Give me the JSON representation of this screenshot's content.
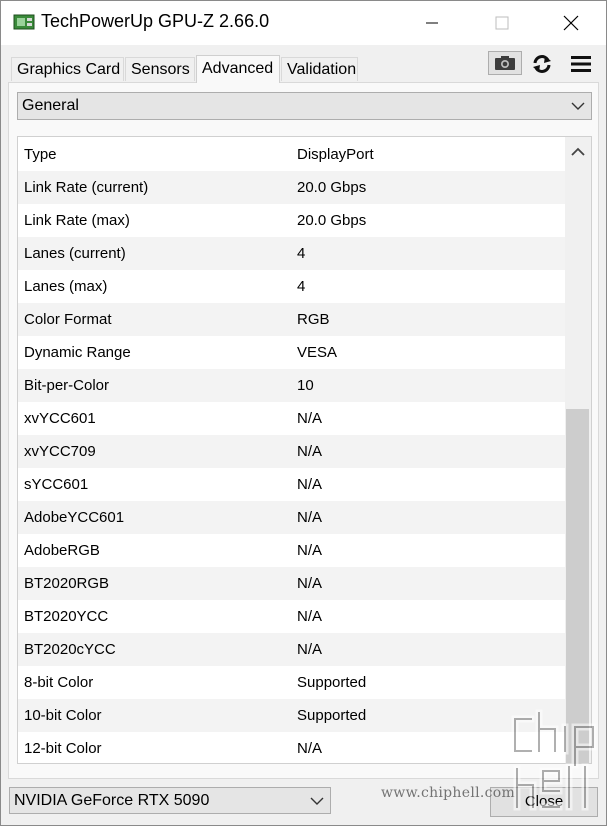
{
  "window": {
    "title": "TechPowerUp GPU-Z 2.66.0"
  },
  "tabs": [
    {
      "label": "Graphics Card",
      "active": false
    },
    {
      "label": "Sensors",
      "active": false
    },
    {
      "label": "Advanced",
      "active": true
    },
    {
      "label": "Validation",
      "active": false
    }
  ],
  "section_dropdown": {
    "selected": "General"
  },
  "rows": [
    {
      "key": "Type",
      "value": "DisplayPort"
    },
    {
      "key": "Link Rate (current)",
      "value": "20.0 Gbps"
    },
    {
      "key": "Link Rate (max)",
      "value": "20.0 Gbps"
    },
    {
      "key": "Lanes (current)",
      "value": "4"
    },
    {
      "key": "Lanes (max)",
      "value": "4"
    },
    {
      "key": "Color Format",
      "value": "RGB"
    },
    {
      "key": "Dynamic Range",
      "value": "VESA"
    },
    {
      "key": "Bit-per-Color",
      "value": "10"
    },
    {
      "key": "xvYCC601",
      "value": "N/A"
    },
    {
      "key": "xvYCC709",
      "value": "N/A"
    },
    {
      "key": "sYCC601",
      "value": "N/A"
    },
    {
      "key": "AdobeYCC601",
      "value": "N/A"
    },
    {
      "key": "AdobeRGB",
      "value": "N/A"
    },
    {
      "key": "BT2020RGB",
      "value": "N/A"
    },
    {
      "key": "BT2020YCC",
      "value": "N/A"
    },
    {
      "key": "BT2020cYCC",
      "value": "N/A"
    },
    {
      "key": "8-bit Color",
      "value": "Supported"
    },
    {
      "key": "10-bit Color",
      "value": "Supported"
    },
    {
      "key": "12-bit Color",
      "value": "N/A"
    }
  ],
  "gpu_select": {
    "selected": "NVIDIA GeForce RTX 5090"
  },
  "close_button": {
    "label": "Close"
  },
  "watermark": {
    "url": "www.chiphell.com",
    "logo_text": "chip hell"
  },
  "icons": {
    "app": "gpu-card-icon",
    "minimize": "minimize-icon",
    "maximize": "maximize-icon",
    "close": "close-icon",
    "screenshot": "camera-icon",
    "refresh": "refresh-icon",
    "menu": "hamburger-menu-icon"
  }
}
